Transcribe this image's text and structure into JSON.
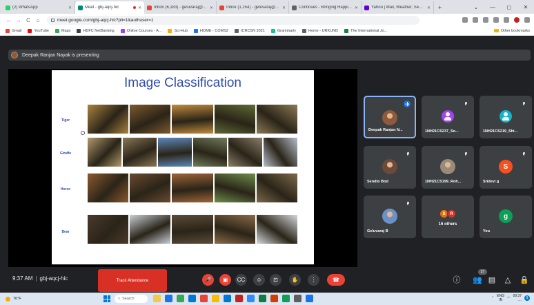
{
  "browser": {
    "tabs": [
      {
        "label": "(2) WhatsApp",
        "favicon_color": "#25d366",
        "active": false
      },
      {
        "label": "Meet - gbj-aqcj-hic",
        "favicon_color": "#00897b",
        "active": true,
        "recording": true
      },
      {
        "label": "Inbox (6,183) - geluvaraj@...",
        "favicon_color": "#ea4335",
        "active": false
      },
      {
        "label": "Inbox (1,254) - geluvaraj@...",
        "favicon_color": "#ea4335",
        "active": false
      },
      {
        "label": "Continues - Bringing Happi...",
        "favicon_color": "#5f6368",
        "active": false
      },
      {
        "label": "Yahoo | Mail, Weather, Sear...",
        "favicon_color": "#6001d2",
        "active": false
      }
    ],
    "new_tab": "+",
    "window_controls": [
      "⌄",
      "—",
      "◻",
      "✕"
    ],
    "url": "meet.google.com/gbj-aqcj-hic?pli=1&authuser=1",
    "bookmarks": [
      {
        "label": "Gmail",
        "color": "#ea4335"
      },
      {
        "label": "YouTube",
        "color": "#ff0000"
      },
      {
        "label": "Maps",
        "color": "#34a853"
      },
      {
        "label": "HDFC NetBanking",
        "color": "#3c4043"
      },
      {
        "label": "Online Courses - A...",
        "color": "#a142f4"
      },
      {
        "label": "Sci-Hub",
        "color": "#f9ab00"
      },
      {
        "label": "HOME - COMS2",
        "color": "#1a73e8"
      },
      {
        "label": "ICRCSN 2021",
        "color": "#5f6368"
      },
      {
        "label": "Grammarly",
        "color": "#15c39a"
      },
      {
        "label": "Home - URKUND",
        "color": "#5f6368"
      },
      {
        "label": "The International Jo...",
        "color": "#188038"
      }
    ],
    "other_bookmarks": "Other bookmarks"
  },
  "meet": {
    "presenter_banner": "Deepak Ranjan Nayak is presenting",
    "slide": {
      "title": "Image Classification",
      "rows": [
        {
          "label": "Tiger",
          "colors": [
            "#a9823f",
            "#7d5a2c",
            "#c08a3e",
            "#5f6a34",
            "#8c7a55"
          ]
        },
        {
          "label": "Giraffe",
          "colors": [
            "#b29a6c",
            "#8b7656",
            "#5d87b8",
            "#6f7c5c",
            "#8a7e6a",
            "#b7bfcc"
          ]
        },
        {
          "label": "Horse",
          "colors": [
            "#8a5a2e",
            "#6a4a2f",
            "#9c6438",
            "#6e8d4a",
            "#7b6a4c"
          ]
        },
        {
          "label": "Bear",
          "colors": [
            "#4a3a2c",
            "#c9cfd6",
            "#5a4b38",
            "#8a6a48",
            "#d6d9dc"
          ]
        }
      ]
    },
    "participants": [
      {
        "name": "Deepak Ranjan N...",
        "avatar": "photo",
        "avatar_color": "#8d5a3b",
        "speaking": true
      },
      {
        "name": "1NH21CS237_So...",
        "avatar": "glyph",
        "avatar_color": "#a142f4",
        "muted": true
      },
      {
        "name": "1NH21CS219_Shi...",
        "avatar": "glyph",
        "avatar_color": "#12b5cb",
        "muted": true
      },
      {
        "name": "Sendto Bod",
        "avatar": "photo",
        "avatar_color": "#6b4a3a",
        "muted": true
      },
      {
        "name": "1NH21CS199_Roh...",
        "avatar": "photo",
        "avatar_color": "#9a8a7a",
        "muted": true
      },
      {
        "name": "Sridevi g",
        "avatar": "letter",
        "letter": "S",
        "avatar_color": "#f4511e",
        "muted": true
      },
      {
        "name": "Geluvaraj B",
        "avatar": "photo",
        "avatar_color": "#6a92c9",
        "muted": true
      },
      {
        "name": "You",
        "avatar": "letter",
        "letter": "g",
        "avatar_color": "#0f9d58",
        "muted": false
      }
    ],
    "others_tile": {
      "label": "16 others",
      "chips": [
        {
          "letter": "S",
          "color": "#e8710a"
        },
        {
          "letter": "R",
          "color": "#d93025"
        }
      ]
    },
    "controls": {
      "time": "9:37 AM",
      "meeting_code": "gbj-aqcj-hic",
      "track_attendance": "Track Attendance",
      "people_count": "27",
      "buttons": [
        {
          "name": "mic-off-button",
          "glyph": "🎤",
          "red": true
        },
        {
          "name": "camera-off-button",
          "glyph": "▣",
          "red": true
        },
        {
          "name": "captions-button",
          "glyph": "CC",
          "red": false
        },
        {
          "name": "emoji-reactions-button",
          "glyph": "☺",
          "red": false
        },
        {
          "name": "present-now-button",
          "glyph": "⊡",
          "red": false
        },
        {
          "name": "raise-hand-button",
          "glyph": "✋",
          "red": false
        },
        {
          "name": "more-options-button",
          "glyph": "⋮",
          "red": false
        }
      ],
      "hangup_glyph": "☎",
      "right": [
        {
          "name": "meeting-details-icon",
          "glyph": "ⓘ"
        },
        {
          "name": "people-icon",
          "glyph": "👥"
        },
        {
          "name": "chat-icon",
          "glyph": "▤"
        },
        {
          "name": "activities-icon",
          "glyph": "△"
        },
        {
          "name": "host-controls-icon",
          "glyph": "🔒"
        }
      ]
    }
  },
  "taskbar": {
    "temperature": "76°F",
    "search": "Search",
    "apps": [
      "#f2c94c",
      "#1a73e8",
      "#34a853",
      "#0078d4",
      "#ea4335",
      "#fbbc04",
      "#0078d4",
      "#c5221f",
      "#2d8cff",
      "#107c41",
      "#d83b01",
      "#0f9d58",
      "#5e5e5e",
      "#1a73e8"
    ],
    "lang": "ENG",
    "region": "IN",
    "time": "09:37",
    "date": "…",
    "notification_count": "9"
  }
}
